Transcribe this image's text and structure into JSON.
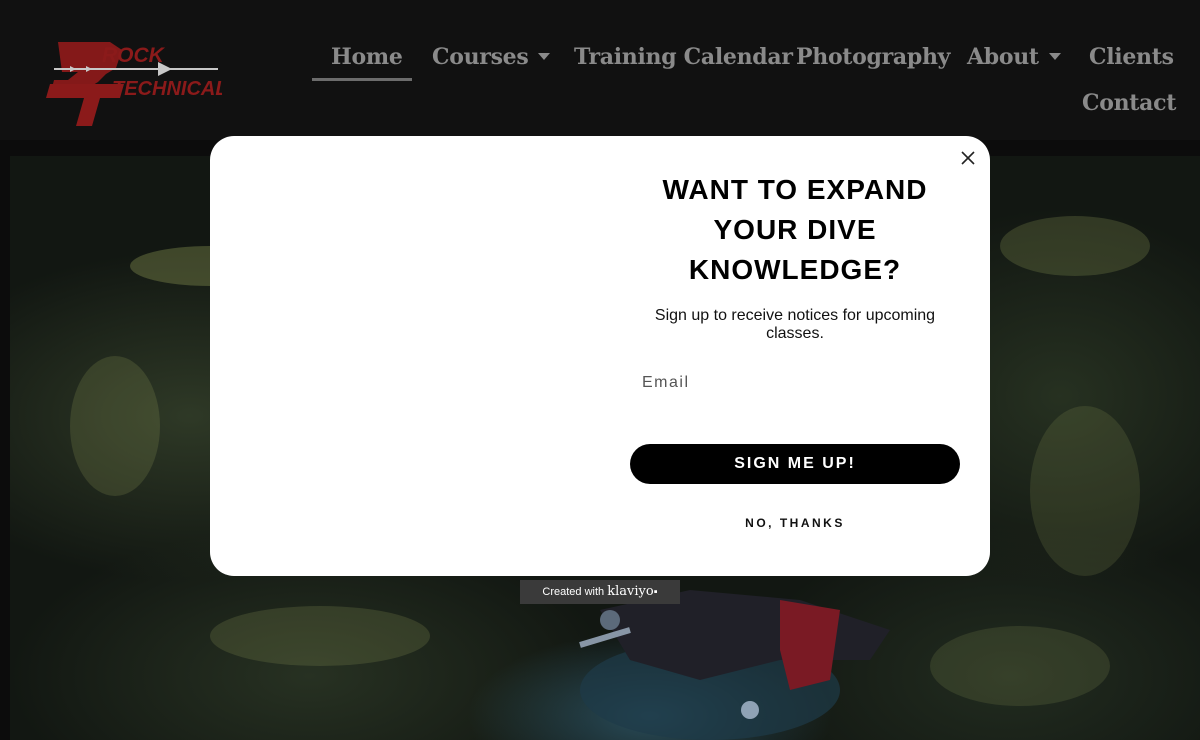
{
  "colors": {
    "header_bg": "#111111",
    "nav_text": "#8a8a8a",
    "logo_red": "#8b1a1a",
    "popup_bg": "#ffffff",
    "button_bg": "#000000",
    "badge_bg": "#3a3a3a"
  },
  "logo": {
    "line1": "ROCK",
    "line2": "TECHNICAL",
    "monogram": "BT"
  },
  "nav": {
    "items": [
      {
        "label": "Home",
        "active": true
      },
      {
        "label": "Courses",
        "dropdown": true
      },
      {
        "label": "Training Calendar"
      },
      {
        "label": "Photography"
      },
      {
        "label": "About",
        "dropdown": true
      },
      {
        "label": "Clients"
      },
      {
        "label": "Contact"
      }
    ]
  },
  "popup": {
    "title": "WANT TO EXPAND YOUR DIVE KNOWLEDGE?",
    "subtitle": "Sign up to receive notices for upcoming classes.",
    "email_placeholder": "Email",
    "email_value": "",
    "submit_label": "SIGN ME UP!",
    "decline_label": "NO, THANKS",
    "close_icon": "close-icon"
  },
  "badge": {
    "prefix": "Created with",
    "brand": "klaviyo"
  }
}
